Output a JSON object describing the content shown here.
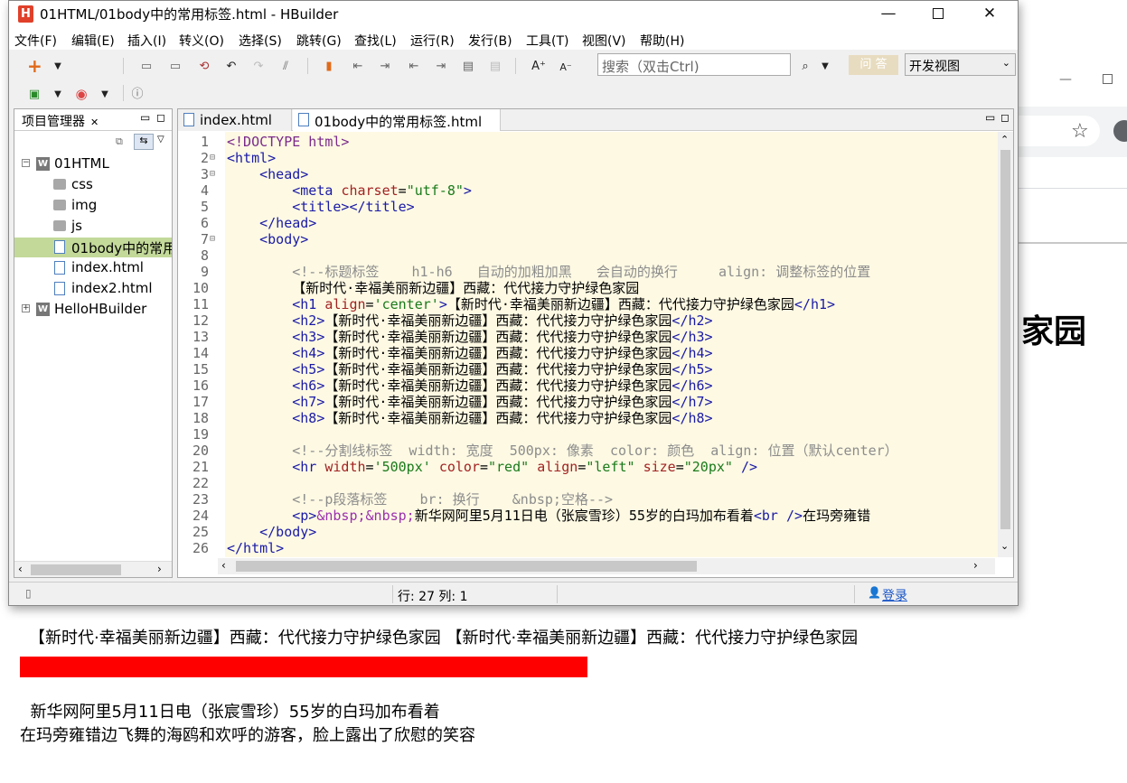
{
  "window": {
    "title": "01HTML/01body中的常用标签.html - HBuilder",
    "logo": "H"
  },
  "menu": [
    "文件(F)",
    "编辑(E)",
    "插入(I)",
    "转义(O)",
    "选择(S)",
    "跳转(G)",
    "查找(L)",
    "运行(R)",
    "发行(B)",
    "工具(T)",
    "视图(V)",
    "帮助(H)"
  ],
  "toolbar": {
    "search_placeholder": "搜索（双击Ctrl)",
    "qa_label": "问 答",
    "view_select": "开发视图"
  },
  "project_panel": {
    "title": "项目管理器",
    "tree": [
      {
        "label": "01HTML",
        "type": "project",
        "expanded": true
      },
      {
        "label": "css",
        "type": "folder"
      },
      {
        "label": "img",
        "type": "folder"
      },
      {
        "label": "js",
        "type": "folder"
      },
      {
        "label": "01body中的常用",
        "type": "file",
        "selected": true
      },
      {
        "label": "index.html",
        "type": "file"
      },
      {
        "label": "index2.html",
        "type": "file"
      },
      {
        "label": "HelloHBuilder",
        "type": "project",
        "expanded": false
      }
    ]
  },
  "editor": {
    "tabs": [
      "index.html",
      "01body中的常用标签.html"
    ],
    "active_tab": 1,
    "line_numbers": [
      "1",
      "2",
      "3",
      "4",
      "5",
      "6",
      "7",
      "8",
      "9",
      "10",
      "11",
      "12",
      "13",
      "14",
      "15",
      "16",
      "17",
      "18",
      "19",
      "20",
      "21",
      "22",
      "23",
      "24",
      "25",
      "26"
    ]
  },
  "status": {
    "position": "行: 27 列: 1",
    "login": "登录"
  },
  "browser": {
    "heading_tail": "家园",
    "headings_text": "【新时代·幸福美丽新边疆】西藏：代代接力守护绿色家园 【新时代·幸福美丽新边疆】西藏：代代接力守护绿色家园",
    "hr_color": "#ff0000",
    "paragraph_line1": "  新华网阿里5月11日电（张宸雪珍）55岁的白玛加布看着",
    "paragraph_line2": "在玛旁雍错边飞舞的海鸥和欢呼的游客，脸上露出了欣慰的笑容"
  }
}
